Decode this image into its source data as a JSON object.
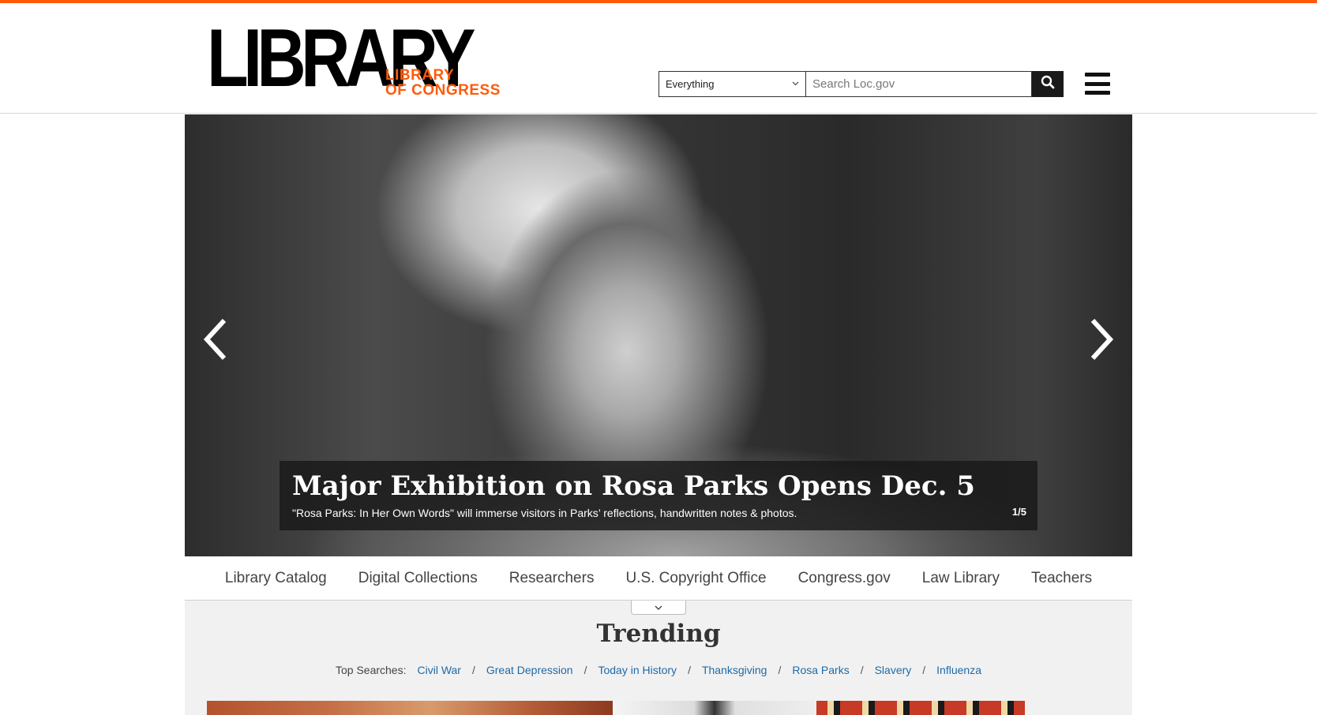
{
  "colors": {
    "accent": "#ff5a0a",
    "link": "#1e6aa8",
    "dark": "#1a1a1a"
  },
  "logo": {
    "main": "LIBRARY",
    "line1": "LIBRARY",
    "line2": "OF CONGRESS"
  },
  "search": {
    "scope": "Everything",
    "placeholder": "Search Loc.gov",
    "button_icon": "search-icon",
    "menu_icon": "hamburger-menu-icon"
  },
  "hero": {
    "title": "Major Exhibition on Rosa Parks Opens Dec. 5",
    "text": "\"Rosa Parks: In Her Own Words\" will immerse visitors in Parks’ reflections, handwritten notes & photos.",
    "counter": "1/5",
    "prev_icon": "chevron-left-icon",
    "next_icon": "chevron-right-icon"
  },
  "nav": {
    "items": [
      "Library Catalog",
      "Digital Collections",
      "Researchers",
      "U.S. Copyright Office",
      "Congress.gov",
      "Law Library",
      "Teachers"
    ]
  },
  "trending": {
    "title": "Trending",
    "label": "Top Searches:",
    "links": [
      "Civil War",
      "Great Depression",
      "Today in History",
      "Thanksgiving",
      "Rosa Parks",
      "Slavery",
      "Influenza"
    ],
    "separator": "/"
  }
}
